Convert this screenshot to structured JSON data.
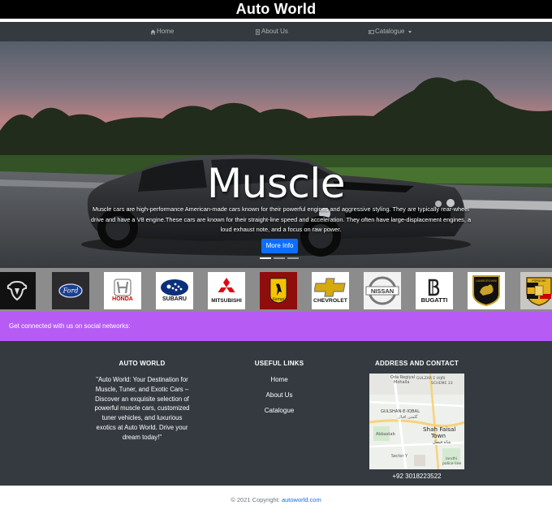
{
  "header": {
    "title": "Auto World"
  },
  "nav": {
    "home": {
      "label": "Home",
      "icon": "home-icon"
    },
    "about": {
      "label": "About Us",
      "icon": "id-card-icon"
    },
    "catalogue": {
      "label": "Catalogue",
      "icon": "card-icon"
    }
  },
  "hero": {
    "title": "Muscle",
    "description": "Muscle cars are high-performance American-made cars known for their powerful engines and aggressive styling. They are typically rear-wheel drive and have a V8 engine.These cars are known for their straight-line speed and acceleration. They often have large-displacement engines, a loud exhaust note, and a focus on raw power.",
    "button_label": "More Info",
    "slides": 3,
    "active_slide": 1
  },
  "brands": [
    {
      "name": "Dodge",
      "text": ""
    },
    {
      "name": "Ford",
      "text": "Ford"
    },
    {
      "name": "Honda",
      "text": "HONDA"
    },
    {
      "name": "Subaru",
      "text": "SUBARU"
    },
    {
      "name": "Mitsubishi",
      "text": "MITSUBISHI"
    },
    {
      "name": "Ferrari",
      "text": "Ferrari"
    },
    {
      "name": "Chevrolet",
      "text": "CHEVROLET"
    },
    {
      "name": "Nissan",
      "text": "NISSAN"
    },
    {
      "name": "Bugatti",
      "text": "BUGATTI"
    },
    {
      "name": "Lamborghini",
      "text": "LAMBORGHINI"
    },
    {
      "name": "Porsche",
      "text": "PORSCHE"
    }
  ],
  "social": {
    "text": "Get connected with us on social networks:"
  },
  "footer": {
    "about_heading": "AUTO WORLD",
    "about_text": "\"Auto World: Your Destination for Muscle, Tuner, and Exotic Cars – Discover an exquisite selection of powerful muscle cars, customized tuner vehicles, and luxurious exotics at Auto World. Drive your dream today!\"",
    "links_heading": "USEFUL LINKS",
    "links": [
      "Home",
      "About Us",
      "Catalogue"
    ],
    "contact_heading": "ADDRESS AND CONTACT",
    "map_labels": {
      "oda": "Oda Regiyal",
      "mohalla": "Mohalla",
      "gulzar1": "GULZAR E HIJRI",
      "gulzar2": "SCHEME 33",
      "gulshan": "GULSHAN-E-IQBAL",
      "gulshan_urdu": "گلشن اقبال",
      "shah1": "Shah Faisal",
      "shah2": "Town",
      "shah_urdu": "شاہ فیصل",
      "abbas": "Abbastab",
      "sector": "Sector Y",
      "landhi1": "landhi",
      "landhi2": "police line"
    },
    "phone": "+92 3018223522"
  },
  "bottom": {
    "copyright": "© 2021 Copyright: ",
    "link": "autoworld.com"
  },
  "colors": {
    "header_bg": "#000000",
    "nav_bg": "#343a40",
    "social_bar": "#b65cf5",
    "button": "#0d6efd",
    "brand_strip": "#8c8c8c"
  }
}
